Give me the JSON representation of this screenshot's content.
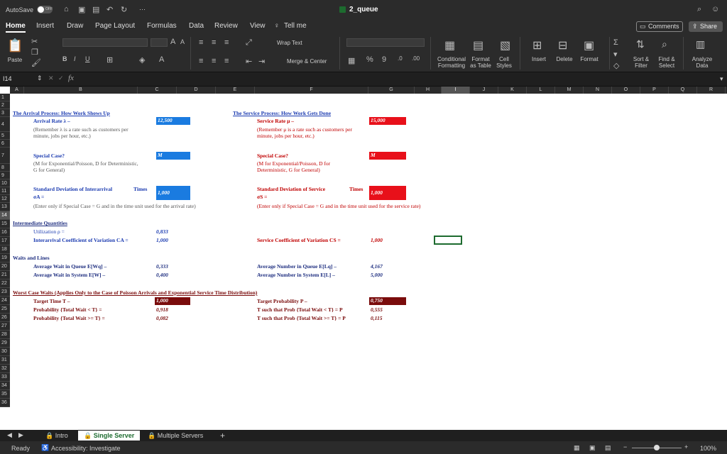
{
  "app": {
    "autosave_label": "AutoSave",
    "autosave_state": "OFF",
    "doc_title": "2_queue",
    "more": "···"
  },
  "tabs": [
    "Home",
    "Insert",
    "Draw",
    "Page Layout",
    "Formulas",
    "Data",
    "Review",
    "View"
  ],
  "tell_me": "Tell me",
  "comments_label": "Comments",
  "share_label": "Share",
  "ribbon": {
    "paste": "Paste",
    "wrap_text": "Wrap Text",
    "merge_center": "Merge & Center",
    "percent": "%",
    "comma": "9",
    "conditional_formatting": [
      "Conditional",
      "Formatting"
    ],
    "format_as_table": [
      "Format",
      "as Table"
    ],
    "cell_styles": [
      "Cell",
      "Styles"
    ],
    "insert": "Insert",
    "delete": "Delete",
    "format": "Format",
    "sort_filter": [
      "Sort &",
      "Filter"
    ],
    "find_select": [
      "Find &",
      "Select"
    ],
    "analyze_data": [
      "Analyze",
      "Data"
    ],
    "font_a_big": "A",
    "font_a_small": "A",
    "bold": "B",
    "italic": "I",
    "underline": "U"
  },
  "formula_bar": {
    "name_box": "I14",
    "fx": "fx",
    "content": ""
  },
  "columns": [
    "A",
    "B",
    "C",
    "D",
    "E",
    "F",
    "G",
    "H",
    "I",
    "J",
    "K",
    "L",
    "M",
    "N",
    "O",
    "P",
    "Q",
    "R",
    "S"
  ],
  "rows": [
    "1",
    "2",
    "3",
    "4",
    "5",
    "6",
    "7",
    "8",
    "9",
    "10",
    "11",
    "12",
    "13",
    "14",
    "15",
    "16",
    "17",
    "18",
    "19",
    "20",
    "21",
    "22",
    "23",
    "24",
    "25",
    "26",
    "27",
    "28",
    "29",
    "30",
    "31",
    "32",
    "33",
    "34",
    "35",
    "36"
  ],
  "sheet": {
    "arrival_title": "The Arrival Process: How Work Shows Up",
    "arrival_rate_label": "Arrival Rate λ –",
    "arrival_rate_value": "12,500",
    "arrival_note_1": "(Remember λ is a rate such as customers per",
    "arrival_note_2": "minute, jobs per hour, etc.)",
    "service_title": "The Service Process: How Work Gets Done",
    "service_rate_label": "Service Rate μ –",
    "service_rate_value": "15,000",
    "service_note_1": "(Remember μ is a rate such as customers per",
    "service_note_2": "minute, jobs per hour, etc.)",
    "special_case_a": "Special Case?",
    "special_case_a_value": "M",
    "special_note_a_1": "(M for Exponential/Poisson, D for Deterministic,",
    "special_note_a_2": "G for General)",
    "special_case_s": "Special Case?",
    "special_case_s_value": "M",
    "special_note_s_1": "(M for Exponential/Poisson, D for",
    "special_note_s_2": "Deterministic, G for General)",
    "sd_arrival_label": "Standard Deviation of Interarrival",
    "sd_arrival_times": "Times",
    "sd_arrival_sym": "σA =",
    "sd_arrival_value": "1,000",
    "sd_arrival_note": "(Enter only if Special Case = G and in the time unit used for the arrival rate)",
    "sd_service_label": "Standard Deviation of Service",
    "sd_service_times": "Times",
    "sd_service_sym": "σS =",
    "sd_service_value": "1,000",
    "sd_service_note": "(Enter only if Special Case = G and in the time unit used for the service rate)",
    "intermediate_title": "Intermediate Quantities",
    "utilization_label": "Utilization ρ =",
    "utilization_value": "0,833",
    "cva_label": "Interarrival Coefficient of Variation CA =",
    "cva_value": "1,000",
    "cvs_label": "Service Coefficient of Variation CS =",
    "cvs_value": "1,000",
    "waits_title": "Waits and Lines",
    "wq_label": "Average Wait in Queue E[Wq] –",
    "wq_value": "0,333",
    "w_label": "Average Wait in System E[W] –",
    "w_value": "0,400",
    "lq_label": "Average Number in Queue E[Lq] –",
    "lq_value": "4,167",
    "l_label": "Average Number in System E[L] –",
    "l_value": "5,000",
    "worst_title": "Worst Case Waits (Applies Only to the Case of Poisson Arrivals and Exponential Service Time Distribution)",
    "target_time_label": "Target Time T –",
    "target_time_value": "1,000",
    "prob_lt_label": "Probability {Total Wait < T} =",
    "prob_lt_value": "0,918",
    "prob_ge_label": "Probability {Total Wait >= T} =",
    "prob_ge_value": "0,082",
    "target_prob_label": "Target Probability P –",
    "target_prob_value": "0,750",
    "t_lt_label": "T such that Prob {Total Wait < T} = P",
    "t_lt_value": "0,555",
    "t_ge_label": "T such that Prob {Total Wait >= T} = P",
    "t_ge_value": "0,115"
  },
  "sheet_tabs": [
    "Intro",
    "Single Server",
    "Multiple Servers"
  ],
  "add_sheet": "+",
  "status": {
    "ready": "Ready",
    "accessibility": "Accessibility: Investigate",
    "zoom": "100%"
  },
  "colors": {
    "blue_input": "#1a7be0",
    "red_input": "#e8101a",
    "dark_red": "#7a0c0c",
    "selection": "#1d6b2f"
  }
}
